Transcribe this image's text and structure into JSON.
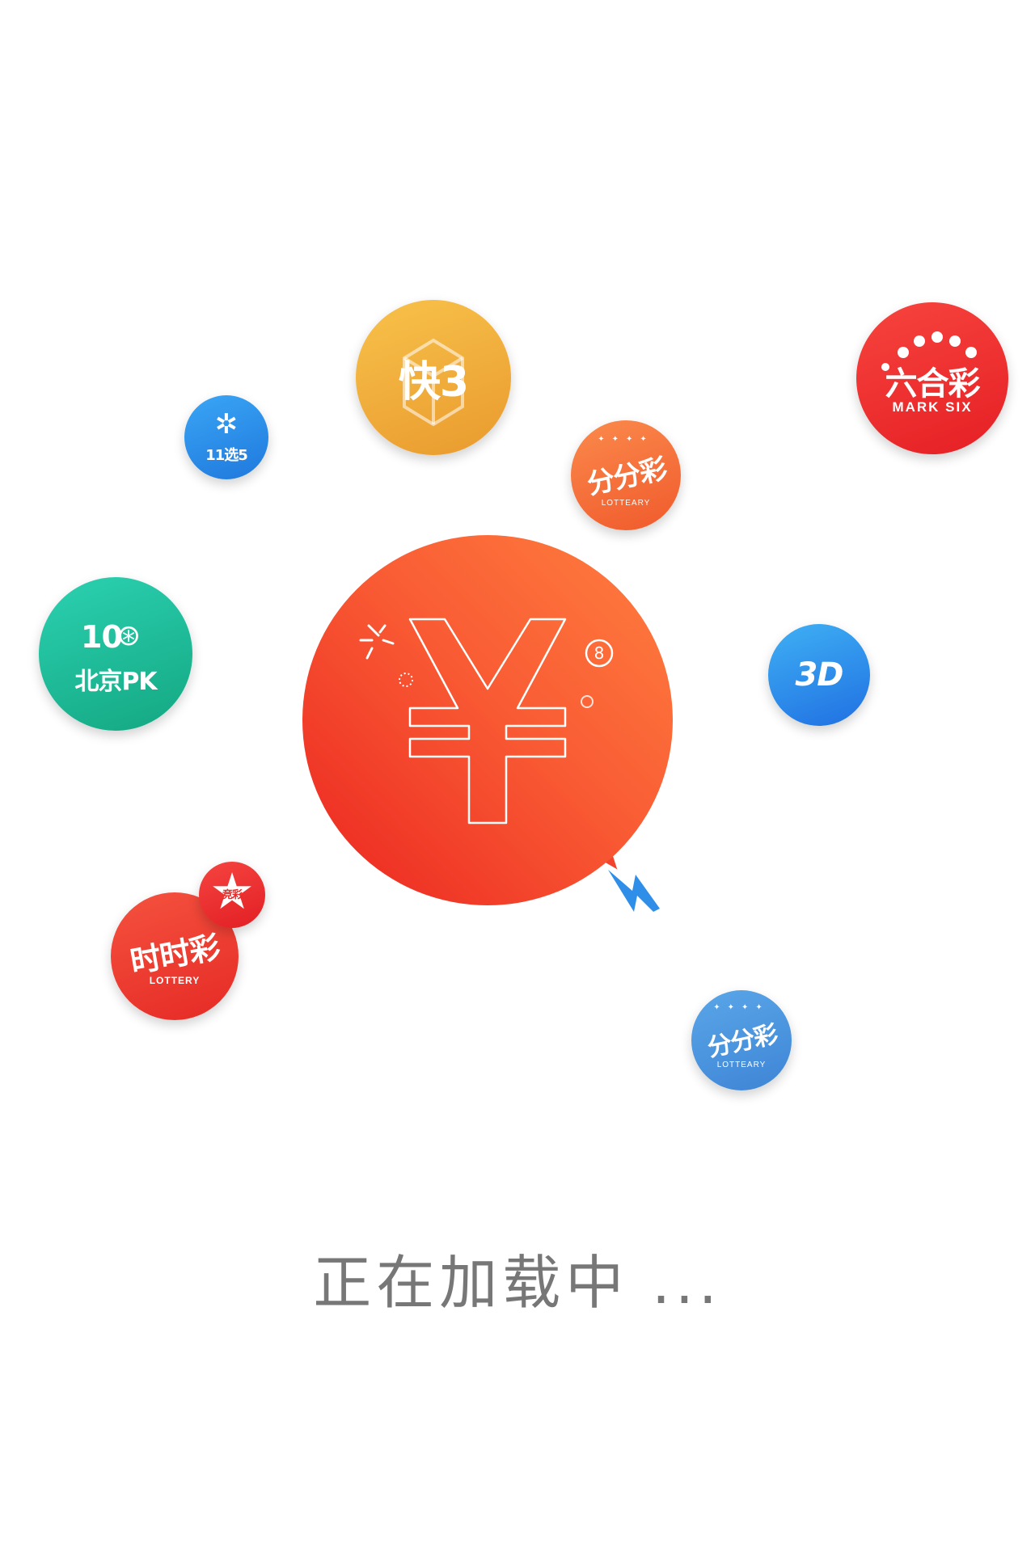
{
  "lotteries": {
    "kuai3": {
      "label": "快3",
      "color": "#f0ae3c"
    },
    "shiyi_xuan_wu": {
      "label": "11选5",
      "color": "#2f8ee8"
    },
    "fenfencai_top": {
      "label": "分分彩",
      "sub": "LOTTEARY",
      "color": "#f76a36"
    },
    "liuhecai": {
      "label": "六合彩",
      "sub": "MARK SIX",
      "color": "#ee2b2b"
    },
    "beijing_pk10": {
      "number": "10",
      "label": "北京PK",
      "color": "#1fbf99"
    },
    "fucai_3d": {
      "label": "3D",
      "color": "#2b89e8"
    },
    "shishicai": {
      "label": "时时彩",
      "sub": "LOTTERY",
      "color": "#ee3b2e"
    },
    "jingcai": {
      "label": "竞彩",
      "color": "#ee2b2b"
    },
    "fenfencai_bottom": {
      "label": "分分彩",
      "sub": "LOTTEARY",
      "color": "#4a95e0"
    }
  },
  "main": {
    "symbol": "¥",
    "ball_number": "8",
    "accent_color": "#f2442c"
  },
  "loading_text": "正在加载中 ..."
}
